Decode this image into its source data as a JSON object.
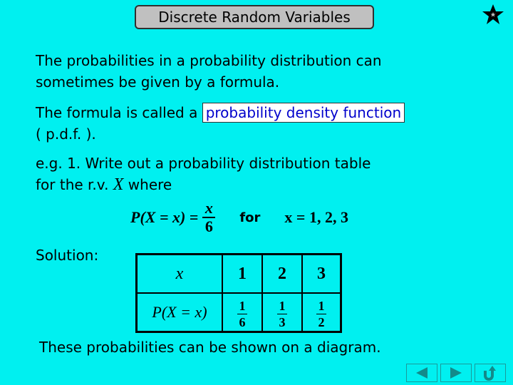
{
  "header": {
    "title": "Discrete Random Variables",
    "corner_icon": "star-icon"
  },
  "intro": {
    "line1": "The probabilities in a probability distribution can",
    "line2": "sometimes be given by a formula."
  },
  "definition": {
    "prefix": "The formula is called a ",
    "term": "probability density function",
    "suffix": "( p.d.f. )."
  },
  "example": {
    "line1": "e.g. 1.  Write out a probability distribution table",
    "line2_pre": "for the r.v. ",
    "variable": "X",
    "line2_post": " where"
  },
  "formula": {
    "lhs": "P(X = x) =",
    "numerator": "x",
    "denominator": "6",
    "for_word": "for",
    "domain": "x = 1, 2, 3"
  },
  "solution": {
    "label": "Solution:",
    "table": {
      "row1_header": "x",
      "row2_header": "P(X = x)",
      "values": [
        "1",
        "2",
        "3"
      ],
      "probabilities": [
        {
          "num": "1",
          "den": "6"
        },
        {
          "num": "1",
          "den": "3"
        },
        {
          "num": "1",
          "den": "2"
        }
      ]
    }
  },
  "closing": "These probabilities can be shown on a diagram.",
  "nav": {
    "prev_icon": "previous-arrow-icon",
    "next_icon": "next-arrow-icon",
    "return_icon": "return-icon"
  }
}
